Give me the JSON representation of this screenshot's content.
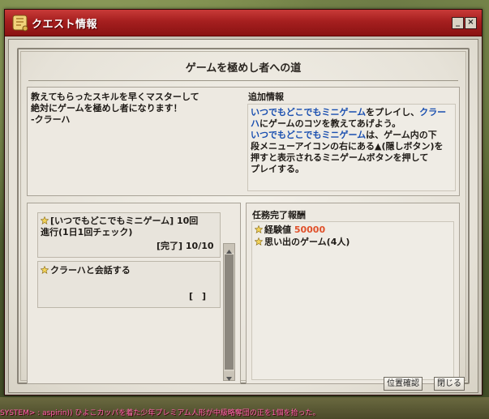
{
  "window": {
    "title": "クエスト情報",
    "minimize_label": "_",
    "close_label": "×"
  },
  "quest": {
    "heading": "ゲームを極めし者への道",
    "description": "教えてもらったスキルを早くマスターして\n絶対にゲームを極めし者になります！\n-クラーハ",
    "additional_title": "追加情報",
    "additional": {
      "p1_link1": "いつでもどこでもミニゲーム",
      "p1_text1": "をプレイし、",
      "p1_link2a": "クラー",
      "p1_link2b": "ハ",
      "p1_text2": "にゲームのコツを教えてあげよう。",
      "p2_link": "いつでもどこでもミニゲーム",
      "p2_text1": "は、ゲーム内の下",
      "p2_text2": "段メニューアイコンの右にある▲(隠しボタン)を",
      "p2_text3": "押すと表示されるミニゲームボタンを押して",
      "p2_text4": "プレイする。"
    },
    "tasks": [
      {
        "title_line1": "[いつでもどこでもミニゲーム] 10回",
        "title_line2": "進行(1日1回チェック)",
        "status": "[完了] 10/10"
      },
      {
        "title_line1": "クラーハと会話する",
        "title_line2": "",
        "status": "[　]"
      }
    ],
    "reward_title": "任務完了報酬",
    "rewards": {
      "exp_label": "経験値",
      "exp_value": "50000",
      "item": "思い出のゲーム(4人)"
    }
  },
  "buttons": {
    "locate": "位置確認",
    "close": "閉じる"
  },
  "system_message": "SYSTEM> : aspirin)) ひよこカッパを着た少年プレミアム人形が中級略奪団の正を1個を拾った。",
  "colors": {
    "title_bar": "#a51f1f",
    "link_blue": "#1a4fb0",
    "exp_value": "#e0502a",
    "system_text": "#ff5fae"
  }
}
